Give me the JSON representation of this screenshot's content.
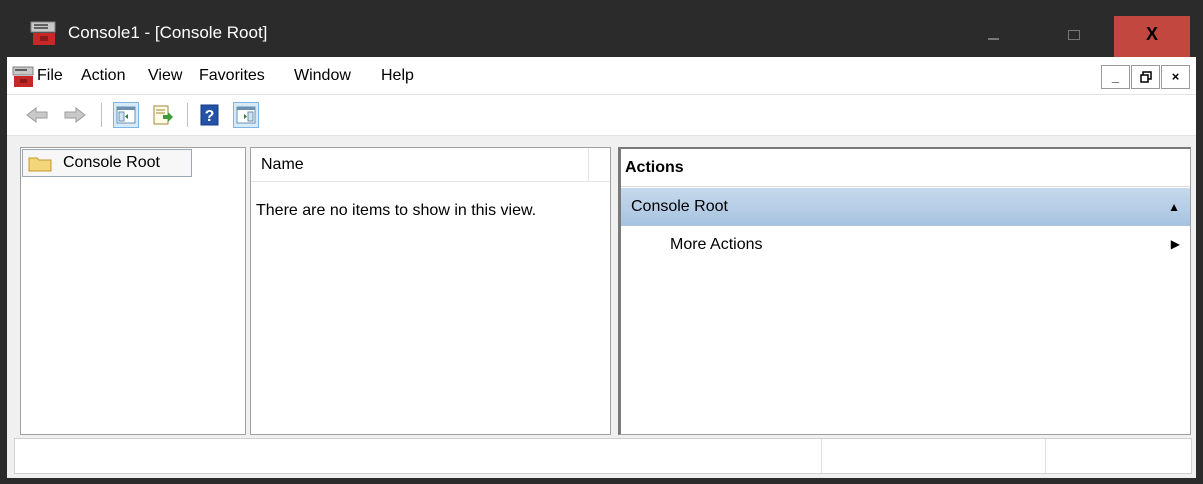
{
  "window": {
    "title": "Console1 - [Console Root]",
    "controls": {
      "minimize": "–",
      "maximize": "□",
      "close": "X"
    },
    "colors": {
      "titlebar": "#2b2b2b",
      "close": "#c2473f",
      "accent": "#a7c3e0"
    }
  },
  "menubar": {
    "items": [
      "File",
      "Action",
      "View",
      "Favorites",
      "Window",
      "Help"
    ],
    "mdi": {
      "minimize": "_",
      "restore": "🗗",
      "close": "×"
    }
  },
  "toolbar": {
    "icons": [
      "back-arrow-icon",
      "forward-arrow-icon",
      "show-hide-console-tree-icon",
      "export-list-icon",
      "help-icon",
      "show-hide-action-pane-icon"
    ]
  },
  "tree": {
    "root_label": "Console Root"
  },
  "list": {
    "column_name": "Name",
    "empty_message": "There are no items to show in this view."
  },
  "actions": {
    "header": "Actions",
    "group_label": "Console Root",
    "items": [
      {
        "label": "More Actions"
      }
    ]
  }
}
